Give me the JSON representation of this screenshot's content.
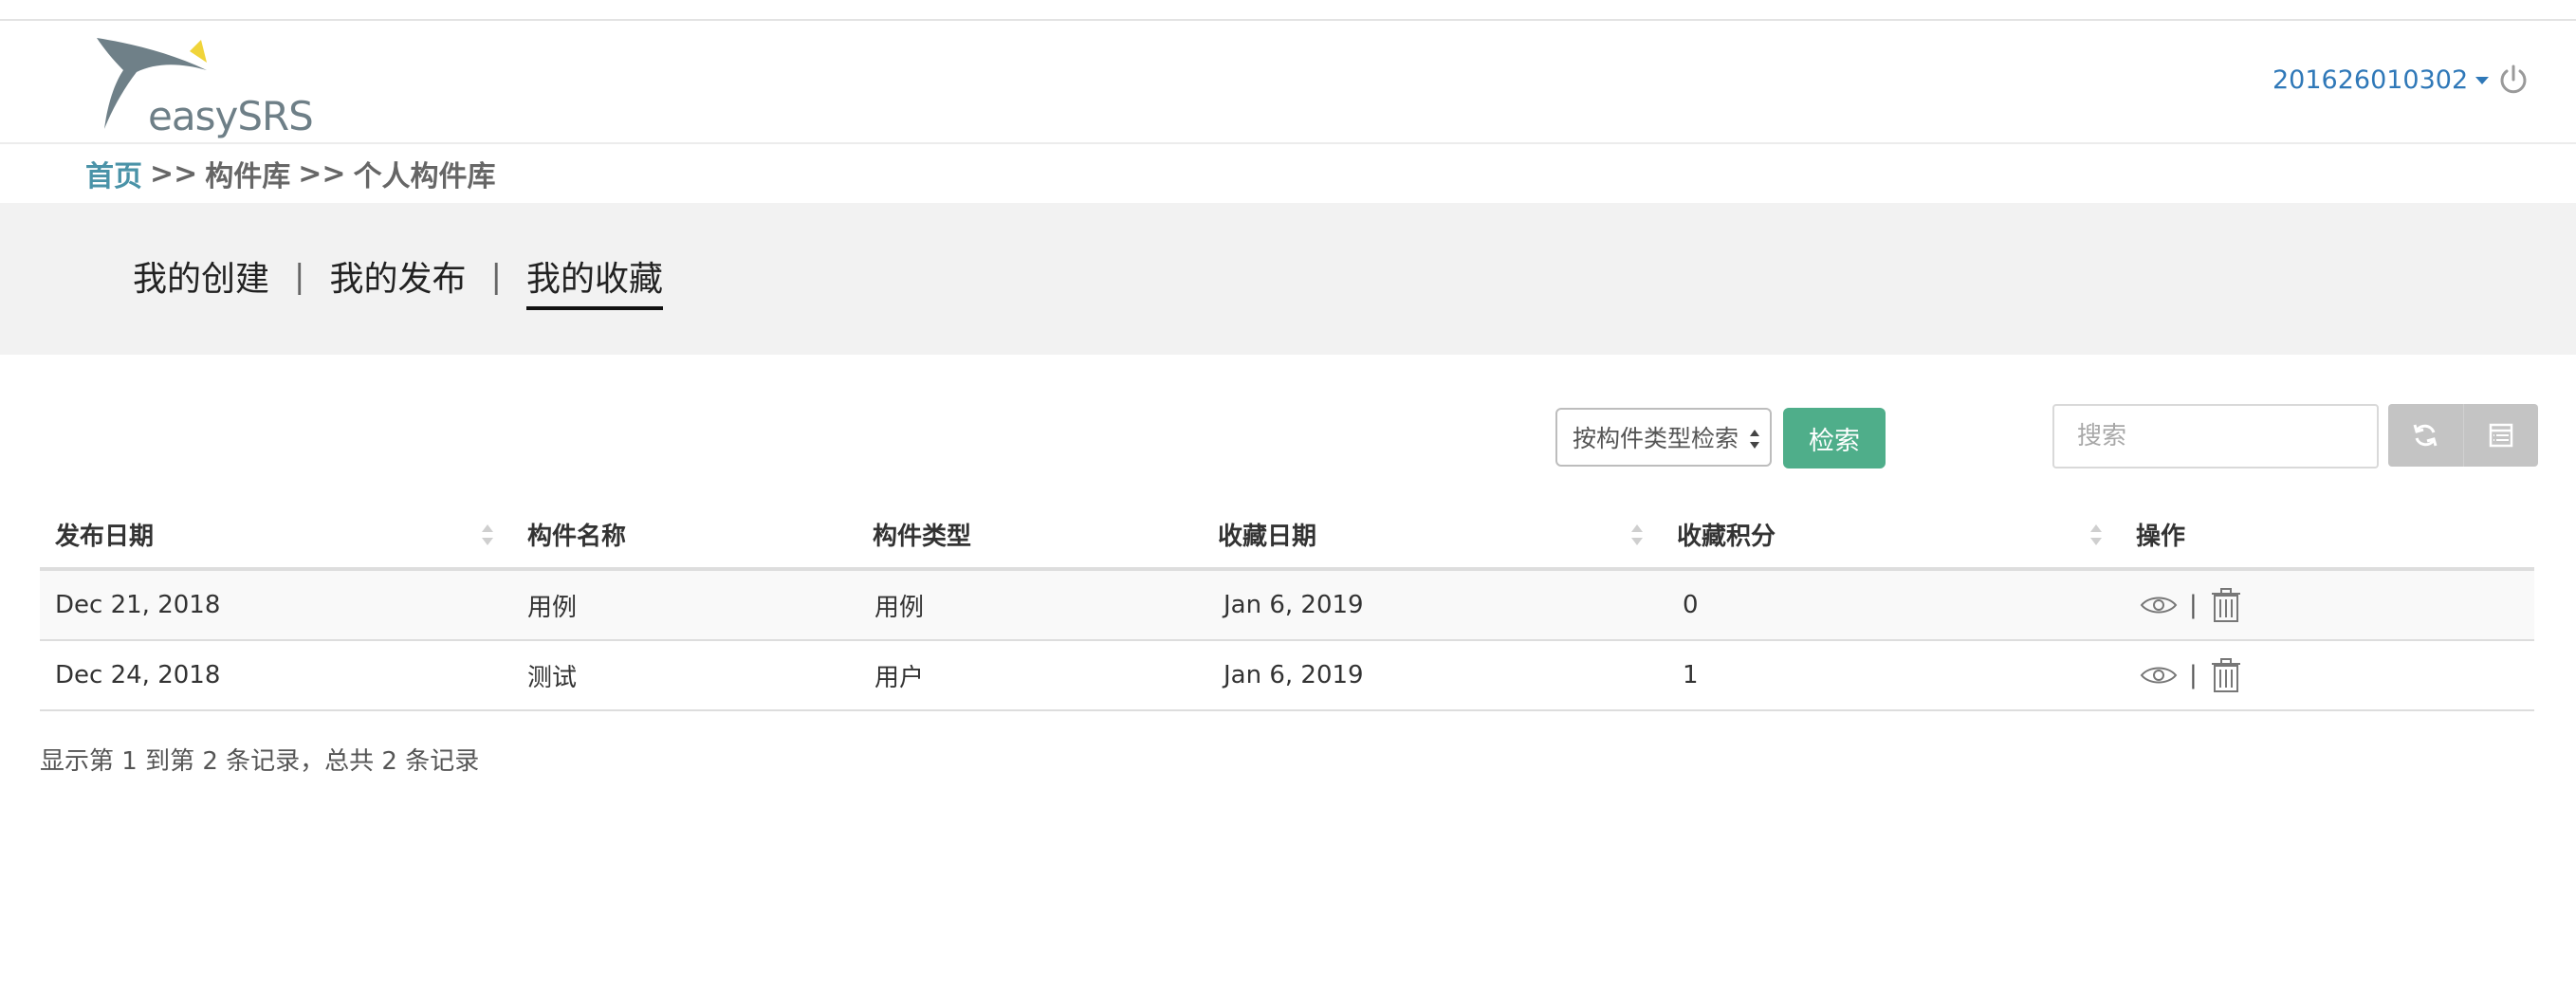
{
  "header": {
    "logo_text": "easySRS",
    "user_name": "201626010302"
  },
  "breadcrumb": {
    "home": "首页",
    "separator": ">>",
    "level1": "构件库",
    "level2": "个人构件库"
  },
  "tabs": [
    {
      "label": "我的创建",
      "active": false
    },
    {
      "label": "我的发布",
      "active": false
    },
    {
      "label": "我的收藏",
      "active": true
    }
  ],
  "tab_divider": "|",
  "toolbar": {
    "filter_select_value": "按构件类型检索",
    "search_button_label": "检索",
    "search_placeholder": "搜索",
    "refresh_icon": "refresh-icon",
    "columns_icon": "columns-list-icon"
  },
  "table": {
    "columns": [
      "发布日期",
      "构件名称",
      "构件类型",
      "收藏日期",
      "收藏积分",
      "操作"
    ],
    "rows": [
      {
        "publish_date": "Dec 21, 2018",
        "name": "用例",
        "type": "用例",
        "fav_date": "Jan 6, 2019",
        "points": "0"
      },
      {
        "publish_date": "Dec 24, 2018",
        "name": "测试",
        "type": "用户",
        "fav_date": "Jan 6, 2019",
        "points": "1"
      }
    ],
    "action_divider": "|",
    "action_icons": [
      "eye-icon",
      "trash-icon"
    ]
  },
  "footer": {
    "info": "显示第 1 到第 2 条记录，总共 2 条记录"
  },
  "colors": {
    "link_blue": "#2f78b8",
    "button_green": "#4fae8a",
    "breadcrumb_home": "#4a93a8",
    "band_gray": "#f2f2f2"
  }
}
